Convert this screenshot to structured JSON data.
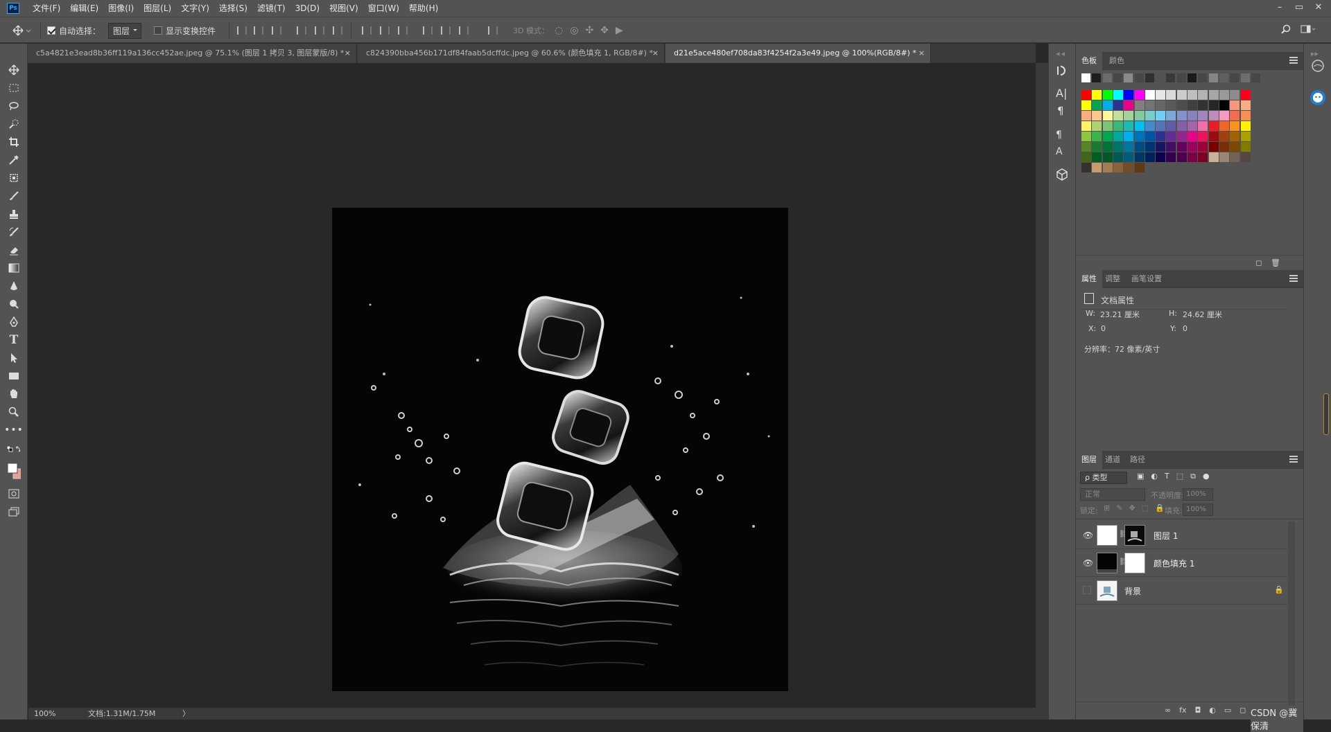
{
  "app": {
    "logo_text": "Ps"
  },
  "menu": [
    "文件(F)",
    "编辑(E)",
    "图像(I)",
    "图层(L)",
    "文字(Y)",
    "选择(S)",
    "滤镜(T)",
    "3D(D)",
    "视图(V)",
    "窗口(W)",
    "帮助(H)"
  ],
  "window_controls": {
    "minimize": "–",
    "restore": "▭",
    "close": "✕"
  },
  "options": {
    "auto_select_label": "自动选择：",
    "auto_select_value": "图层",
    "show_transform_label": "显示变换控件",
    "mode_3d_label": "3D 模式："
  },
  "tabs": [
    {
      "label": "c5a4821e3ead8b36ff119a136cc452ae.jpeg @ 75.1% (图层 1 拷贝 3, 图层蒙版/8) *",
      "close": "×"
    },
    {
      "label": "c824390bba456b171df84faab5dcffdc.jpeg @ 60.6% (颜色填充 1, RGB/8#) *",
      "close": "×"
    },
    {
      "label": "d21e5ace480ef708da83f4254f2a3e49.jpeg @ 100%(RGB/8#) *",
      "close": "×"
    }
  ],
  "status": {
    "zoom": "100%",
    "doc_size": "文档:1.31M/1.75M",
    "arrow": "〉"
  },
  "swatches_panel": {
    "tabs": [
      "色板",
      "颜色"
    ],
    "recent": [
      "#ffffff",
      "#1e1e1e",
      "#6b6b6b",
      "#474747",
      "#8a8a8a",
      "#474747",
      "#303030",
      "#525252",
      "#3a3a3a",
      "#474747",
      "#1a1a1a",
      "#474747",
      "#858585",
      "#5f5f5f",
      "#474747",
      "#6e6e6e",
      "#474747"
    ],
    "rows": [
      [
        "#ff0000",
        "#ffff00",
        "#00ff00",
        "#00ffff",
        "#0000ff",
        "#ff00ff",
        "#ffffff",
        "#e6e6e6",
        "#d9d9d9",
        "#cccccc",
        "#bfbfbf",
        "#b3b3b3",
        "#a6a6a6",
        "#999999",
        "#8c8c8c",
        "#ff0018"
      ],
      [
        "#ffff00",
        "#00a651",
        "#00aeef",
        "#2e3192",
        "#ec008c",
        "#808080",
        "#737373",
        "#666666",
        "#595959",
        "#4d4d4d",
        "#404040",
        "#333333",
        "#262626",
        "#000000",
        "#f7977a",
        "#fbad82"
      ],
      [
        "#f9ad81",
        "#fdc68a",
        "#fff79a",
        "#c4df9b",
        "#a3d39c",
        "#82ca9c",
        "#7accc8",
        "#6dcff6",
        "#7da7d9",
        "#8393ca",
        "#8781bd",
        "#a186be",
        "#bd8cbf",
        "#f49ac1",
        "#f26c4f",
        "#f68e55"
      ],
      [
        "#fff467",
        "#acd372",
        "#7cc576",
        "#3bb878",
        "#1abbb4",
        "#00bff3",
        "#438ccb",
        "#5574b9",
        "#605ca8",
        "#855fa8",
        "#a763a8",
        "#f06eaa",
        "#ed1c24",
        "#f26522",
        "#f7941d",
        "#fff200"
      ],
      [
        "#8dc73f",
        "#39b54a",
        "#00a651",
        "#00a99d",
        "#00aeef",
        "#0072bc",
        "#0054a6",
        "#2e3192",
        "#662d91",
        "#92278f",
        "#ec008c",
        "#ed145b",
        "#9e0b0f",
        "#a0410d",
        "#a36209",
        "#aba000"
      ],
      [
        "#598527",
        "#1a7b30",
        "#007236",
        "#00746b",
        "#0076a3",
        "#004b80",
        "#003471",
        "#1b1464",
        "#440e62",
        "#630460",
        "#9e005d",
        "#9e0039",
        "#790000",
        "#7b2e00",
        "#7d4900",
        "#827b00"
      ],
      [
        "#406618",
        "#005e20",
        "#005826",
        "#005952",
        "#005b7f",
        "#003663",
        "#002157",
        "#0d004c",
        "#32004b",
        "#4b0049",
        "#7b0046",
        "#7a0026",
        "#c7b299",
        "#998675",
        "#736357",
        "#534741"
      ],
      [
        "#37302d",
        "#c69c6e",
        "#a67c52",
        "#8c6239",
        "#754c24",
        "#603913"
      ]
    ]
  },
  "properties_panel": {
    "tabs": [
      "属性",
      "调整",
      "画笔设置"
    ],
    "section_title": "文档属性",
    "w_label": "W:",
    "w_value": "23.21 厘米",
    "h_label": "H:",
    "h_value": "24.62 厘米",
    "x_label": "X:",
    "x_value": "0",
    "y_label": "Y:",
    "y_value": "0",
    "resolution": "分辨率：72 像素/英寸"
  },
  "layers_panel": {
    "tabs": [
      "图层",
      "通道",
      "路径"
    ],
    "filter_label": "ρ 类型",
    "blend_mode": "正常",
    "opacity_label": "不透明度:",
    "opacity_value": "100%",
    "lock_label": "锁定:",
    "fill_label": "填充:",
    "fill_value": "100%",
    "layers": [
      {
        "name": "图层 1",
        "visible": true
      },
      {
        "name": "颜色填充 1",
        "visible": true
      },
      {
        "name": "背景",
        "visible": false
      }
    ]
  },
  "watermark": "CSDN @冀保清"
}
